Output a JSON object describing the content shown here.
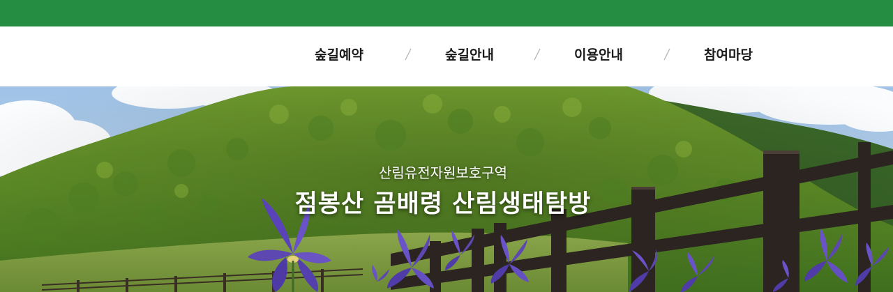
{
  "nav": {
    "items": [
      {
        "label": "숲길예약"
      },
      {
        "label": "숲길안내"
      },
      {
        "label": "이용안내"
      },
      {
        "label": "참여마당"
      }
    ]
  },
  "hero": {
    "subtitle": "산림유전자원보호구역",
    "title": "점봉산 곰배령 산림생태탐방"
  },
  "colors": {
    "top_bar": "#248d41",
    "nav_text": "#1a1a1a",
    "hero_text": "#ffffff"
  }
}
